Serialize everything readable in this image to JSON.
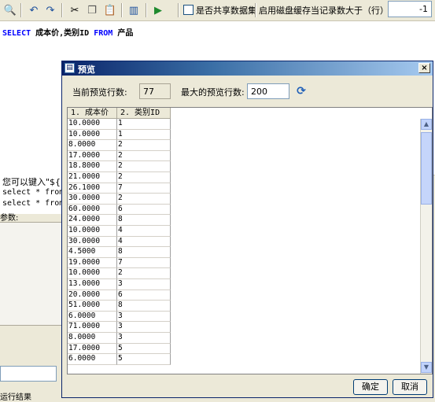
{
  "toolbar": {
    "icons": [
      "print-preview-icon",
      "undo-icon",
      "redo-icon",
      "cut-icon",
      "copy-icon",
      "paste-icon",
      "columns-icon",
      "run-icon"
    ],
    "share_label": "是否共享数据集",
    "disk_label": "启用磁盘缓存当记录数大于（行）",
    "disk_value": "-1"
  },
  "editor": {
    "kw_select": "SELECT",
    "columns": " 成本价,类别ID ",
    "kw_from": "FROM",
    "table": " 产品"
  },
  "background": {
    "hint_line1": "您可以键入\"${",
    "hint_line2": "select * from",
    "hint_line3": "select * from",
    "params_label": "参数:",
    "bottom_text": "运行结果"
  },
  "dialog": {
    "title": "预览",
    "close": "×",
    "current_rows_label": "当前预览行数:",
    "current_rows_value": "77",
    "max_rows_label": "最大的预览行数:",
    "max_rows_value": "200",
    "ok": "确定",
    "cancel": "取消"
  },
  "grid": {
    "headers": [
      "1. 成本价",
      "2. 类别ID"
    ],
    "rows": [
      [
        "10.0000",
        "1"
      ],
      [
        "10.0000",
        "1"
      ],
      [
        "8.0000",
        "2"
      ],
      [
        "17.0000",
        "2"
      ],
      [
        "18.8000",
        "2"
      ],
      [
        "21.0000",
        "2"
      ],
      [
        "26.1000",
        "7"
      ],
      [
        "30.0000",
        "2"
      ],
      [
        "60.0000",
        "6"
      ],
      [
        "24.0000",
        "8"
      ],
      [
        "10.0000",
        "4"
      ],
      [
        "30.0000",
        "4"
      ],
      [
        "4.5000",
        "8"
      ],
      [
        "19.0000",
        "7"
      ],
      [
        "10.0000",
        "2"
      ],
      [
        "13.0000",
        "3"
      ],
      [
        "20.0000",
        "6"
      ],
      [
        "51.0000",
        "8"
      ],
      [
        "6.0000",
        "3"
      ],
      [
        "71.0000",
        "3"
      ],
      [
        "8.0000",
        "3"
      ],
      [
        "17.0000",
        "5"
      ],
      [
        "6.0000",
        "5"
      ]
    ]
  }
}
